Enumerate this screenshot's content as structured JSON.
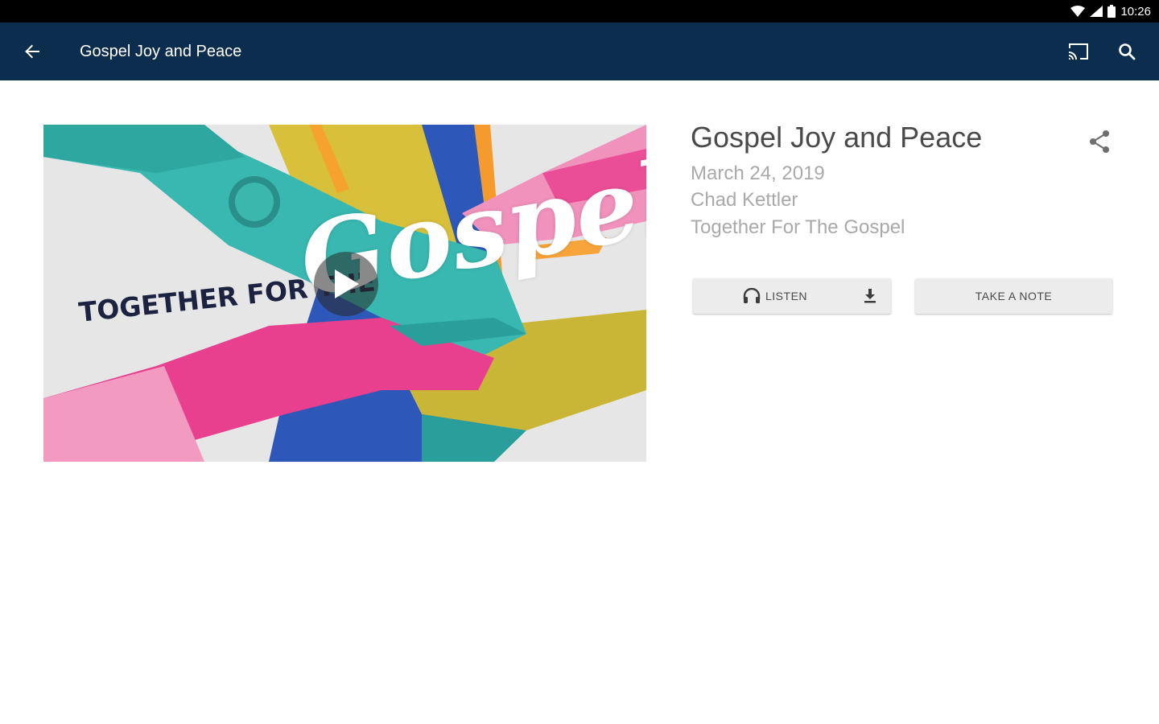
{
  "status_bar": {
    "time": "10:26",
    "icons": [
      "wifi-icon",
      "cellular-signal-icon",
      "battery-icon"
    ]
  },
  "app_bar": {
    "title": "Gospel Joy and Peace",
    "background": "#0d2d4e",
    "icons": [
      "back-arrow-icon",
      "cast-icon",
      "search-icon"
    ]
  },
  "hero": {
    "caption": "TOGETHER FOR THE",
    "script_text": "Gospel",
    "overlay_icon": "play-icon"
  },
  "sermon": {
    "title": "Gospel Joy and Peace",
    "date": "March 24, 2019",
    "speaker": "Chad Kettler",
    "series": "Together For The Gospel",
    "share_icon": "share-icon"
  },
  "actions": {
    "listen_label": "LISTEN",
    "note_label": "TAKE A NOTE",
    "listen_icon": "headphones-icon",
    "download_icon": "download-icon"
  }
}
